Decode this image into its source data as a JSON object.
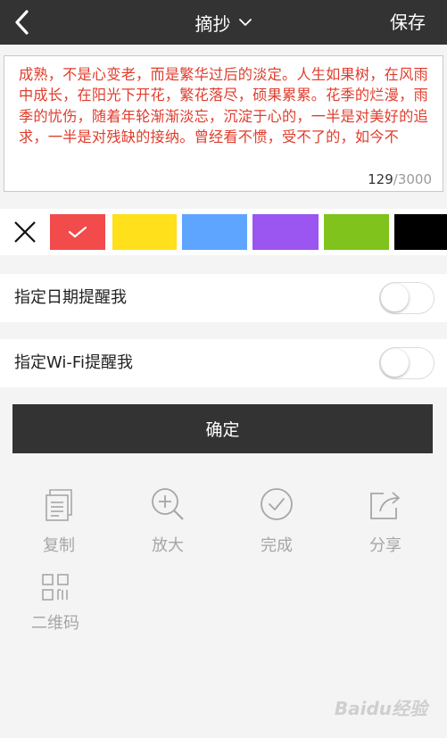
{
  "header": {
    "title": "摘抄",
    "save_label": "保存",
    "back_icon": "chevron-left-icon",
    "dropdown_icon": "chevron-down-icon"
  },
  "editor": {
    "text": "成熟，不是心变老，而是繁华过后的淡定。人生如果树，在风雨中成长，在阳光下开花，繁花落尽，硕果累累。花季的烂漫，雨季的忧伤，随着年轮渐渐淡忘，沉淀于心的，一半是对美好的追求，一半是对残缺的接纳。曾经看不惯，受不了的，如今不",
    "text_color": "#e03c2c",
    "count": "129",
    "max": "/3000"
  },
  "color_palette": {
    "clear_icon": "close-icon",
    "selected_icon": "checkmark-icon",
    "swatches": [
      {
        "name": "red",
        "color": "#f24b4b",
        "selected": true
      },
      {
        "name": "yellow",
        "color": "#ffe01a",
        "selected": false
      },
      {
        "name": "blue",
        "color": "#5ea5ff",
        "selected": false
      },
      {
        "name": "purple",
        "color": "#9b55f0",
        "selected": false
      },
      {
        "name": "green",
        "color": "#7fc31c",
        "selected": false
      },
      {
        "name": "black",
        "color": "#000000",
        "selected": false
      }
    ]
  },
  "reminders": {
    "date_label": "指定日期提醒我",
    "date_enabled": false,
    "wifi_label": "指定Wi-Fi提醒我",
    "wifi_enabled": false
  },
  "confirm_label": "确定",
  "tools": [
    {
      "label": "复制",
      "icon": "copy-icon"
    },
    {
      "label": "放大",
      "icon": "zoom-in-icon"
    },
    {
      "label": "完成",
      "icon": "check-circle-icon"
    },
    {
      "label": "分享",
      "icon": "share-icon"
    },
    {
      "label": "二维码",
      "icon": "qr-code-icon"
    }
  ],
  "watermark": "Baidu经验"
}
